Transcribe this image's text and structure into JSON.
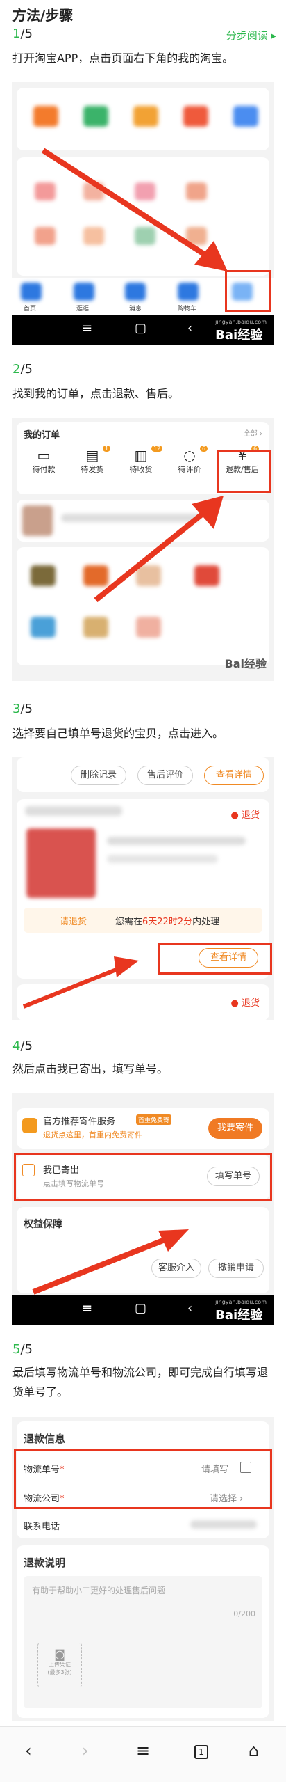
{
  "header": {
    "title": "方法/步骤",
    "fold_label": "分步阅读 ▸"
  },
  "steps": [
    {
      "num": "1",
      "total": "/5",
      "text": "打开淘宝APP，点击页面右下角的我的淘宝。"
    },
    {
      "num": "2",
      "total": "/5",
      "text": "找到我的订单，点击退款、售后。"
    },
    {
      "num": "3",
      "total": "/5",
      "text": "选择要自己填单号退货的宝贝，点击进入。"
    },
    {
      "num": "4",
      "total": "/5",
      "text": "然后点击我已寄出，填写单号。"
    },
    {
      "num": "5",
      "total": "/5",
      "text": "最后填写物流单号和物流公司，即可完成自行填写退货单号了。"
    }
  ],
  "watermark": {
    "brand": "Bai经验",
    "url": "jingyan.baidu.com"
  },
  "shot1": {
    "tabs": [
      "首页",
      "逛逛",
      "消息",
      "购物车",
      ""
    ]
  },
  "shot2": {
    "title": "我的订单",
    "all": "全部 ›",
    "items": [
      {
        "label": "待付款",
        "badge": ""
      },
      {
        "label": "待发货",
        "badge": "1"
      },
      {
        "label": "待收货",
        "badge": "12"
      },
      {
        "label": "待评价",
        "badge": "6"
      },
      {
        "label": "退款/售后",
        "badge": "6"
      }
    ]
  },
  "shot3": {
    "btn_delete": "删除记录",
    "btn_review": "售后评价",
    "btn_detail": "查看详情",
    "refund_tag": "退货",
    "pending": "请退货",
    "notice_pre": "您需在",
    "notice_time": "6天22时2分",
    "notice_post": "内处理",
    "btn_detail2": "查看详情",
    "refund_tag2": "退货"
  },
  "shot4": {
    "service_title": "官方推荐寄件服务",
    "service_badge": "首重免费寄",
    "service_sub": "退货点这里，首重内免费寄件",
    "send_btn": "我要寄件",
    "sent_title": "我已寄出",
    "sent_sub": "点击填写物流单号",
    "fill_btn": "填写单号",
    "rights": "权益保障",
    "btn_service": "客服介入",
    "btn_cancel": "撤销申请"
  },
  "shot5": {
    "section": "退款信息",
    "logistics_no": "物流单号",
    "logistics_no_ph": "请填写",
    "logistics_co": "物流公司",
    "logistics_co_ph": "请选择 ›",
    "phone": "联系电话",
    "explain": "退款说明",
    "explain_ph": "有助于帮助小二更好的处理售后问题",
    "count": "0/200",
    "upload": "上传凭证",
    "upload_sub": "(最多3张)"
  },
  "browser_nav": {
    "back": "‹",
    "forward": "›",
    "menu": "≡",
    "tabs": "1",
    "home": "⌂"
  }
}
